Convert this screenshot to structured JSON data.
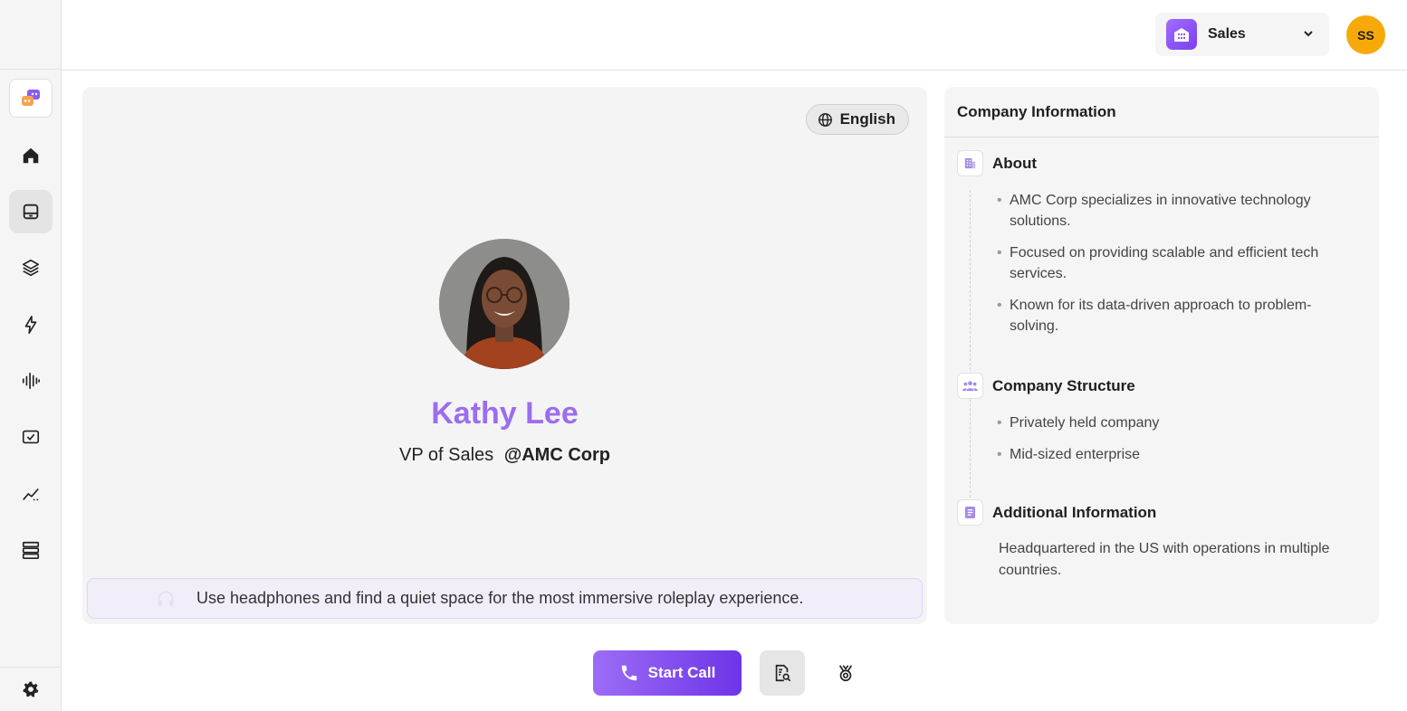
{
  "header": {
    "workspace": {
      "label": "Sales",
      "icon": "building-icon"
    },
    "user_avatar": {
      "initials": "SS",
      "color": "#f7a90a"
    }
  },
  "sidebar": {
    "items": [
      {
        "name": "home",
        "icon": "home-icon"
      },
      {
        "name": "inbox",
        "icon": "inbox-icon",
        "active": true
      },
      {
        "name": "layers",
        "icon": "layers-icon"
      },
      {
        "name": "lightning",
        "icon": "lightning-icon"
      },
      {
        "name": "audio",
        "icon": "waveform-icon"
      },
      {
        "name": "tasks",
        "icon": "checkbox-screen-icon"
      },
      {
        "name": "analytics",
        "icon": "trend-icon"
      },
      {
        "name": "database",
        "icon": "stack-icon"
      }
    ],
    "footer_icon": "gear-icon"
  },
  "persona": {
    "language": "English",
    "name": "Kathy Lee",
    "role": "VP of Sales",
    "company": "@AMC Corp",
    "tip": "Use headphones and find a quiet space for the most immersive roleplay experience."
  },
  "company_info": {
    "title": "Company Information",
    "sections": [
      {
        "title": "About",
        "icon": "building-icon",
        "bullets": [
          "AMC Corp specializes in innovative technology solutions.",
          "Focused on providing scalable and efficient tech services.",
          "Known for its data-driven approach to problem-solving."
        ]
      },
      {
        "title": "Company Structure",
        "icon": "people-icon",
        "bullets": [
          "Privately held company",
          "Mid-sized enterprise"
        ]
      },
      {
        "title": "Additional Information",
        "icon": "document-icon",
        "text": "Headquartered in the US with operations in multiple countries."
      }
    ]
  },
  "actions": {
    "start_call": "Start Call"
  },
  "colors": {
    "accent": "#9b6df0",
    "accent_dark": "#6d35e8",
    "avatar": "#f7a90a"
  }
}
